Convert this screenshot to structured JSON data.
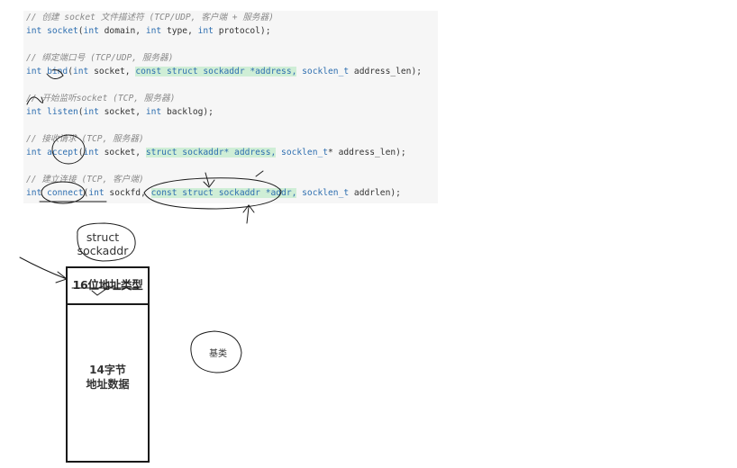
{
  "colors": {
    "code_background": "#f6f6f6",
    "comment": "#8a8a8a",
    "keyword": "#2f6fb0",
    "highlight": "#cfeed6",
    "ink": "#1a1a1a"
  },
  "code": {
    "c1": "// 创建 socket 文件描述符 (TCP/UDP, 客户端 + 服务器)",
    "l1": {
      "kw_int": "int",
      "fn": "socket",
      "t1": "(",
      "t2": " domain, ",
      "t3": " type, ",
      "t4": " protocol);"
    },
    "c2": "// 绑定端口号 (TCP/UDP, 服务器)",
    "l2": {
      "kw_int": "int",
      "fn": "bind",
      "t1": "(",
      "t2": " socket, ",
      "hl": "const struct sockaddr *address,",
      "kw_socklen": "socklen_t",
      "t3": " address_len);"
    },
    "c3": "// 开始监听socket (TCP, 服务器)",
    "l3": {
      "kw_int": "int",
      "fn": "listen",
      "t1": "(",
      "t2": " socket, ",
      "t3": " backlog);"
    },
    "c4": "// 接收请求 (TCP, 服务器)",
    "l4": {
      "kw_int": "int",
      "fn": "accept",
      "t1": "(",
      "t2": " socket, ",
      "hl": "struct sockaddr* address,",
      "kw_socklen": "socklen_t",
      "t3": "* address_len);"
    },
    "c5": "// 建立连接 (TCP, 客户端)",
    "l5": {
      "kw_int": "int",
      "fn": "connect",
      "t1": "(",
      "t2": " sockfd, ",
      "hl": "const struct sockaddr *addr,",
      "kw_socklen": "socklen_t",
      "t3": " addrlen);"
    }
  },
  "diagram": {
    "struct_line1": "struct",
    "struct_line2": "sockaddr",
    "header_field": "16位地址类型",
    "data_line1": "14字节",
    "data_line2": "地址数据",
    "base_label": "基类"
  }
}
